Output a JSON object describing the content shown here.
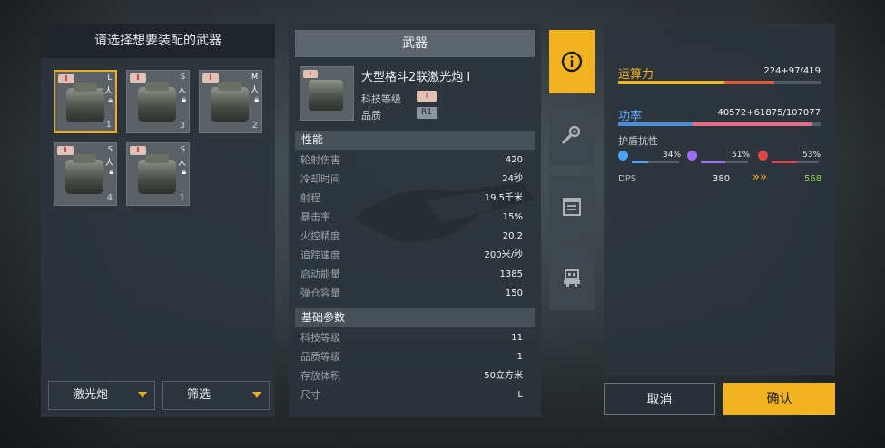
{
  "left": {
    "title": "请选择想要装配的武器",
    "slots": [
      {
        "tag": "I",
        "size": "L",
        "num": "1"
      },
      {
        "tag": "I",
        "size": "S",
        "num": "3"
      },
      {
        "tag": "I",
        "size": "M",
        "num": "2"
      },
      {
        "tag": "I",
        "size": "S",
        "num": "4"
      },
      {
        "tag": "I",
        "size": "S",
        "num": "1"
      }
    ],
    "filter_type": "激光炮",
    "filter_label": "筛选"
  },
  "mid": {
    "header": "武器",
    "weapon_name": "大型格斗2联激光炮 I",
    "tech_label": "科技等级",
    "tech_tag": "I",
    "quality_label": "品质",
    "quality_value": "R1",
    "icon_tag": "I",
    "perf_title": "性能",
    "perf": [
      {
        "k": "轮射伤害",
        "v": "420"
      },
      {
        "k": "冷却时间",
        "v": "24秒"
      },
      {
        "k": "射程",
        "v": "19.5千米"
      },
      {
        "k": "暴击率",
        "v": "15%"
      },
      {
        "k": "火控精度",
        "v": "20.2"
      },
      {
        "k": "追踪速度",
        "v": "200米/秒"
      },
      {
        "k": "启动能量",
        "v": "1385"
      },
      {
        "k": "弹仓容量",
        "v": "150"
      }
    ],
    "base_title": "基础参数",
    "base": [
      {
        "k": "科技等级",
        "v": "11"
      },
      {
        "k": "品质等级",
        "v": "1"
      },
      {
        "k": "存放体积",
        "v": "50立方米"
      },
      {
        "k": "尺寸",
        "v": "L"
      }
    ]
  },
  "tabs": [
    {
      "icon": "info-icon",
      "active": true
    },
    {
      "icon": "wrench-gear-icon",
      "active": false
    },
    {
      "icon": "document-list-icon",
      "active": false
    },
    {
      "icon": "robot-icon",
      "active": false
    }
  ],
  "right": {
    "compute_label": "运算力",
    "compute_value": "224+97/419",
    "compute_fill": 0.77,
    "power_label": "功率",
    "power_value": "40572+61875/107077",
    "power_fill": 0.96,
    "shield_label": "护盾抗性",
    "resists": [
      {
        "pct": "34%",
        "color": "#4aa3ff",
        "fill": 0.34
      },
      {
        "pct": "51%",
        "color": "#a46bff",
        "fill": 0.51
      },
      {
        "pct": "53%",
        "color": "#e04545",
        "fill": 0.53
      }
    ],
    "dps_label": "DPS",
    "dps_from": "380",
    "dps_arrows": "»»",
    "dps_to": "568"
  },
  "buttons": {
    "cancel": "取消",
    "confirm": "确认"
  },
  "colors": {
    "accent": "#f2b320",
    "compute_bar": "#f2b320",
    "power_bar_a": "#4a8fd8",
    "power_bar_b": "#e0708a",
    "dps_increase": "#8fd14f"
  }
}
